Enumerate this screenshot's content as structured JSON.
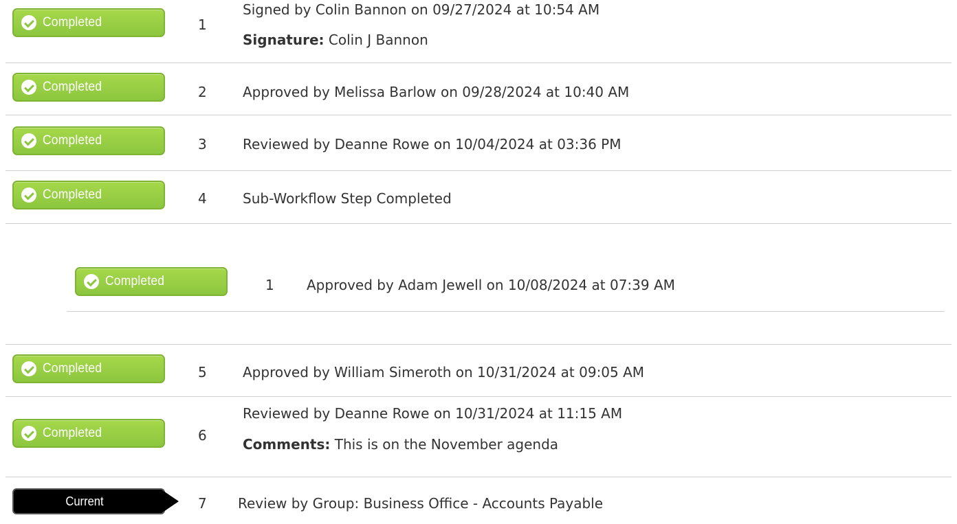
{
  "status_labels": {
    "completed": "Completed",
    "current": "Current"
  },
  "colors": {
    "completed_badge": "#8cc63f",
    "current_badge": "#000000",
    "text": "#333333",
    "divider": "#cfcfcf"
  },
  "steps": [
    {
      "number": "1",
      "status": "Completed",
      "text": "Signed by Colin Bannon on 09/27/2024 at 10:54 AM",
      "detail_label": "Signature:",
      "detail_value": "Colin J Bannon"
    },
    {
      "number": "2",
      "status": "Completed",
      "text": "Approved by Melissa Barlow on 09/28/2024 at 10:40 AM"
    },
    {
      "number": "3",
      "status": "Completed",
      "text": "Reviewed by Deanne Rowe on 10/04/2024 at 03:36 PM"
    },
    {
      "number": "4",
      "status": "Completed",
      "text": "Sub-Workflow Step Completed"
    },
    {
      "number": "5",
      "status": "Completed",
      "text": "Approved by William Simeroth on 10/31/2024 at 09:05 AM"
    },
    {
      "number": "6",
      "status": "Completed",
      "text": "Reviewed by Deanne Rowe on 10/31/2024 at 11:15 AM",
      "detail_label": "Comments:",
      "detail_value": "This is on the November agenda"
    },
    {
      "number": "7",
      "status": "Current",
      "text": "Review by Group: Business Office - Accounts Payable"
    }
  ],
  "sub_steps": [
    {
      "number": "1",
      "status": "Completed",
      "text": "Approved by Adam Jewell on 10/08/2024 at 07:39 AM"
    }
  ]
}
